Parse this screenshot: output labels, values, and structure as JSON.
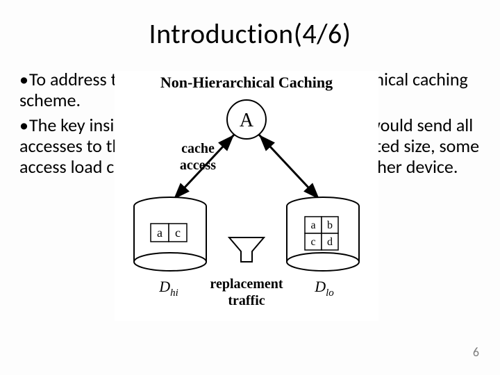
{
  "slide": {
    "title": "Introduction(4/6)",
    "page_number": "6",
    "bullets": [
      "To address this issue, we propose a non-hierarchical caching scheme.",
      "The key insight is that whereas classic caching would send all accesses to the performance device that has limited size, some access load can be dynamically offloaded to another device."
    ]
  },
  "diagram": {
    "heading": "Non-Hierarchical Caching",
    "process": "A",
    "cache_label": "cache",
    "access_label": "access",
    "left_cells": [
      "a",
      "c"
    ],
    "right_cells": [
      "a",
      "b",
      "c",
      "d"
    ],
    "footer_top": "replacement",
    "footer_bottom": "traffic",
    "d_hi_base": "D",
    "d_hi_sub": "hi",
    "d_lo_base": "D",
    "d_lo_sub": "lo"
  }
}
